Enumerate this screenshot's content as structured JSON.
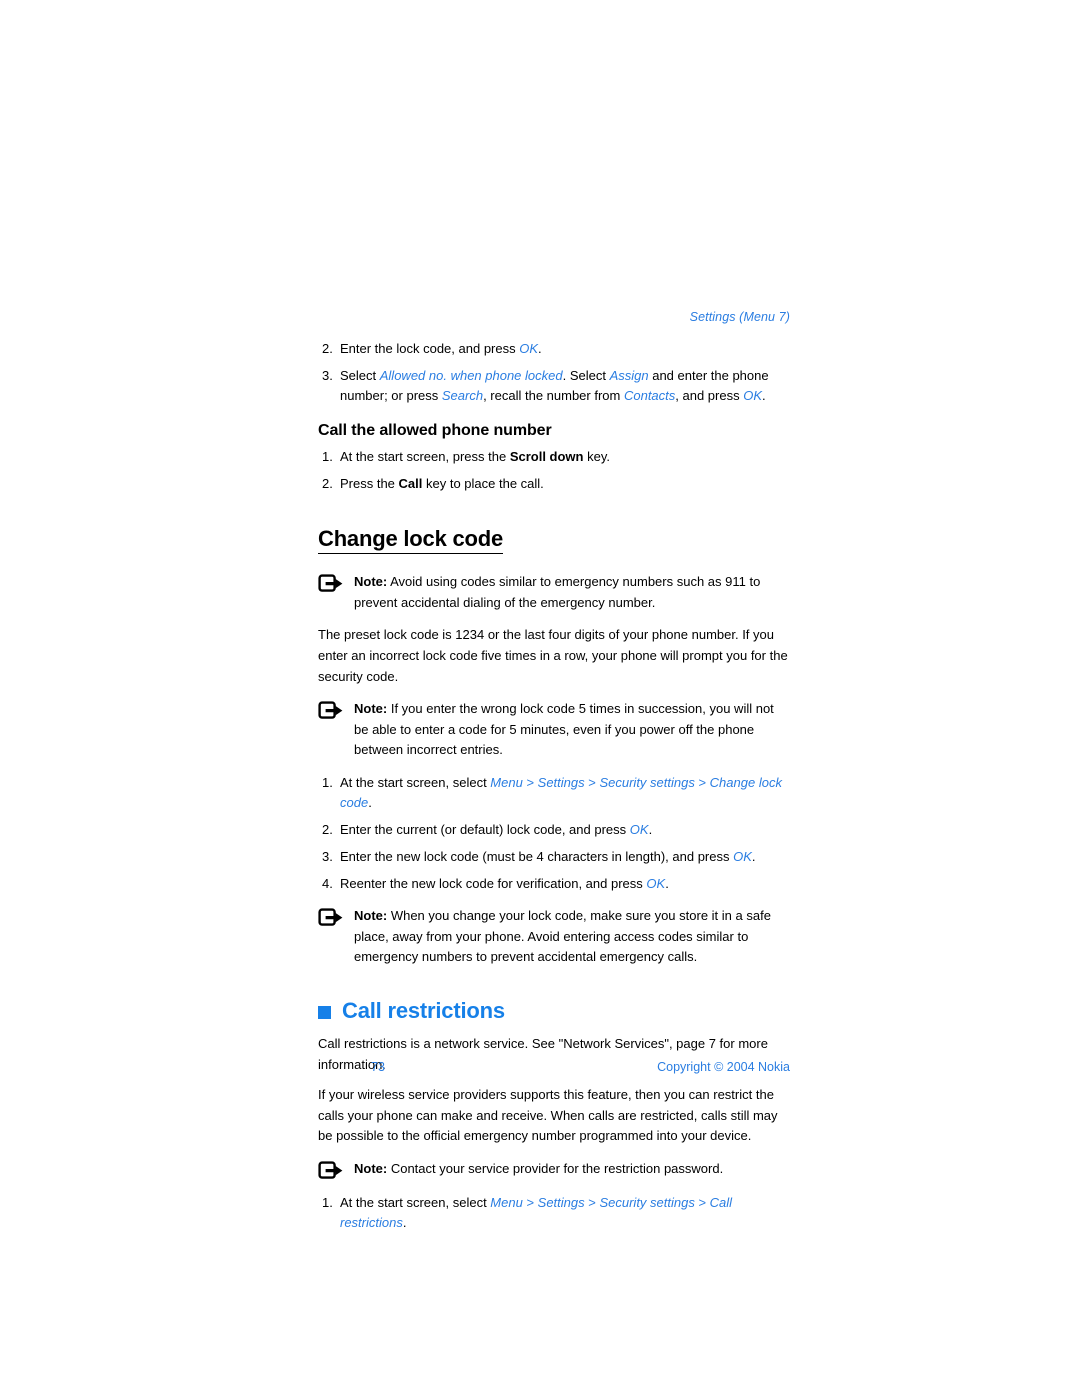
{
  "document": {
    "running_head": "Settings (Menu 7)",
    "page_number": "73",
    "copyright": "Copyright © 2004 Nokia",
    "colors": {
      "link_blue": "#2a7de1",
      "heading_blue": "#1680e8",
      "body_black": "#000000",
      "page_background": "#ffffff"
    }
  },
  "allowed_number_steps": {
    "step2": {
      "num": "2.",
      "pre": "Enter the lock code, and press ",
      "link": "OK",
      "post": "."
    },
    "step3": {
      "num": "3.",
      "a": "Select ",
      "link1": "Allowed no. when phone locked",
      "b": ". Select ",
      "link2": "Assign",
      "c": " and enter the phone number; or press ",
      "link3": "Search",
      "d": ", recall the number from ",
      "link4": "Contacts",
      "e": ", and press ",
      "link5": "OK",
      "f": "."
    }
  },
  "call_allowed": {
    "heading": "Call the allowed phone number",
    "step1": {
      "num": "1.",
      "a": "At the start screen, press the ",
      "kbd": "Scroll down",
      "b": " key."
    },
    "step2": {
      "num": "2.",
      "a": "Press the ",
      "kbd": "Call",
      "b": " key to place the call."
    }
  },
  "change_lock_code": {
    "heading": "Change lock code",
    "note1": {
      "label": "Note:",
      "text": " Avoid using codes similar to emergency numbers such as 911 to prevent accidental dialing of the emergency number."
    },
    "paragraph": "The preset lock code is 1234 or the last four digits of your phone number. If you enter an incorrect lock code five times in a row, your phone will prompt you for the security code.",
    "note2": {
      "label": "Note:",
      "text": " If you enter the wrong lock code 5 times in succession, you will not be able to enter a code for 5 minutes, even if you power off the phone between incorrect entries."
    },
    "step1": {
      "num": "1.",
      "a": "At the start screen, select ",
      "link1": "Menu",
      "sep1": " > ",
      "link2": "Settings",
      "sep2": " > ",
      "link3": "Security settings",
      "sep3": " > ",
      "link4": "Change lock code",
      "end": "."
    },
    "step2": {
      "num": "2.",
      "a": "Enter the current (or default) lock code, and press ",
      "link": "OK",
      "b": "."
    },
    "step3": {
      "num": "3.",
      "a": "Enter the new lock code (must be 4 characters in length), and press ",
      "link": "OK",
      "b": "."
    },
    "step4": {
      "num": "4.",
      "a": "Reenter the new lock code for verification, and press ",
      "link": "OK",
      "b": "."
    },
    "note3": {
      "label": "Note:",
      "text": " When you change your lock code, make sure you store it in a safe place, away from your phone. Avoid entering access codes similar to emergency numbers to prevent accidental emergency calls."
    }
  },
  "call_restrictions": {
    "heading": "Call restrictions",
    "paragraph1": "Call restrictions is a network service. See \"Network Services\", page 7 for more information.",
    "paragraph2": "If your wireless service providers supports this feature, then you can restrict the calls your phone can make and receive. When calls are restricted, calls still may be possible to the official emergency number programmed into your device.",
    "note1": {
      "label": "Note:",
      "text": " Contact your service provider for the restriction password."
    },
    "step1": {
      "num": "1.",
      "a": "At the start screen, select ",
      "link1": "Menu",
      "sep1": " > ",
      "link2": "Settings",
      "sep2": " > ",
      "link3": "Security settings",
      "sep3": " > ",
      "link4": "Call restrictions",
      "end": "."
    }
  },
  "icons": {
    "note": "note-arrow-icon",
    "section_bullet": "square-bullet-icon"
  }
}
